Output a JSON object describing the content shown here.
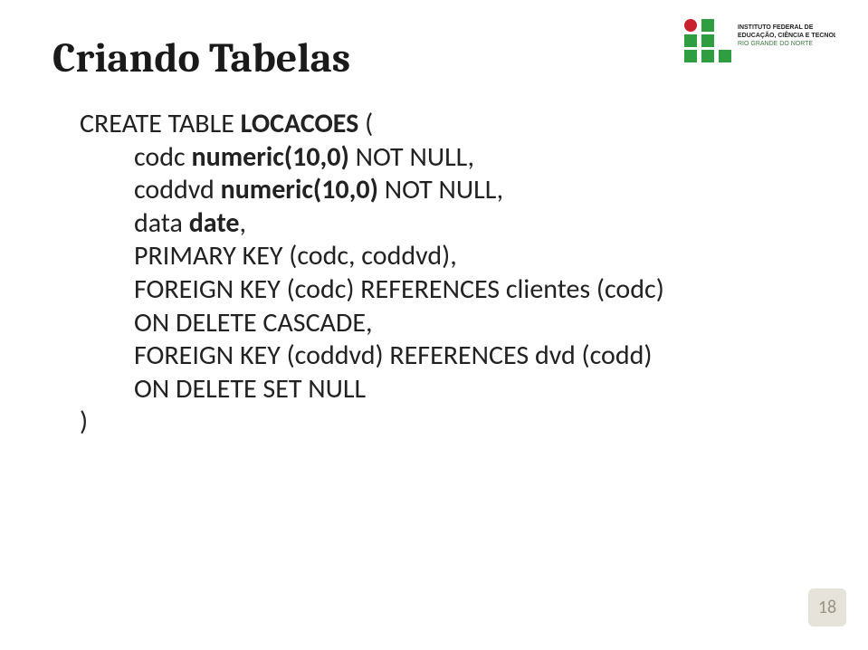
{
  "title": "Criando Tabelas",
  "code": {
    "l1a": "CREATE TABLE ",
    "l1b": "LOCACOES",
    "l1c": " (",
    "l2a": "codc ",
    "l2b": "numeric(10,0)",
    "l2c": " NOT NULL,",
    "l3a": "coddvd ",
    "l3b": "numeric(10,0)",
    "l3c": " NOT NULL,",
    "l4a": "data ",
    "l4b": "date",
    "l4c": ",",
    "l5": "PRIMARY KEY (codc, coddvd),",
    "l6": "FOREIGN KEY (codc) REFERENCES clientes (codc)",
    "l7": "ON DELETE CASCADE,",
    "l8": "FOREIGN KEY (coddvd) REFERENCES dvd (codd)",
    "l9": "ON DELETE SET NULL",
    "l10": ")"
  },
  "page_number": "18",
  "logo": {
    "line1": "INSTITUTO FEDERAL DE",
    "line2": "EDUCAÇÃO, CIÊNCIA E TECNOLOGIA",
    "line3": "RIO GRANDE DO NORTE"
  }
}
